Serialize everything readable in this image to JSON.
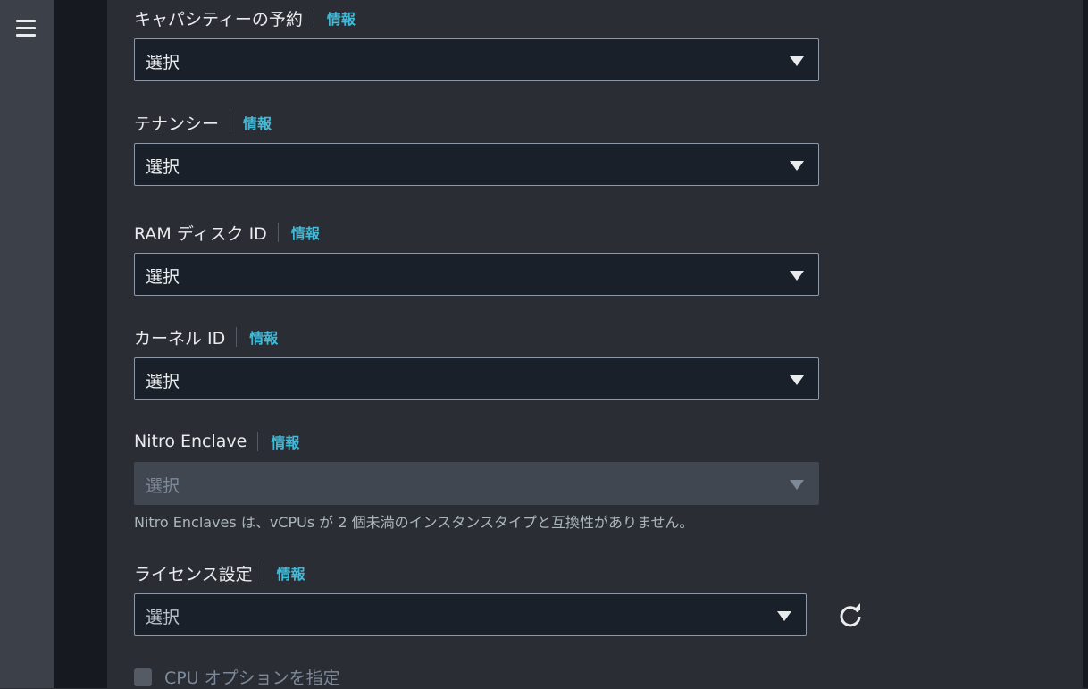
{
  "nav": {
    "menu_icon": "hamburger-menu-icon"
  },
  "info_label": "情報",
  "fields": [
    {
      "label": "キャパシティーの予約",
      "value": "選択"
    },
    {
      "label": "テナンシー",
      "value": "選択"
    },
    {
      "label": "RAM ディスク ID",
      "value": "選択"
    },
    {
      "label": "カーネル ID",
      "value": "選択"
    },
    {
      "label": "Nitro Enclave",
      "value": "選択",
      "disabled": true,
      "hint": "Nitro Enclaves は、vCPUs が 2 個未満のインスタンスタイプと互換性がありません。"
    },
    {
      "label": "ライセンス設定",
      "value": "選択"
    }
  ],
  "refresh_icon": "refresh-icon",
  "cpu_options": {
    "label": "CPU オプションを指定",
    "checked": false,
    "disabled": true
  },
  "colors": {
    "accent": "#44b9d6",
    "background": "#2a2d34",
    "input_bg": "#1a2029"
  }
}
